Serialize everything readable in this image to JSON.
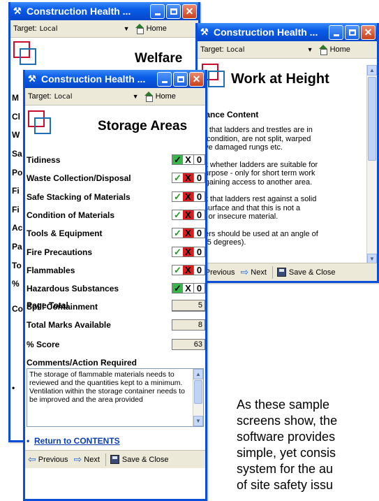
{
  "app_title": "Construction Health ...",
  "target_label": "Target:",
  "target_value": "Local",
  "home_label": "Home",
  "back_window": {
    "heading": "Welfare",
    "fragments": [
      "M",
      "Cl",
      "W",
      "Sa",
      "Po",
      "Fi",
      "Fi",
      "Ac",
      "Pa",
      "To",
      "%",
      "Co",
      "•"
    ]
  },
  "right_window": {
    "heading": "Work at Height",
    "guidance_title": "dance Content",
    "guidance_lines": [
      "re that ladders and trestles are in",
      "d condition, are not split, warped",
      "ave damaged rungs etc.",
      "",
      "ck whether ladders are suitable for",
      "purpose - only for short term work",
      "r gaining access to another area.",
      "",
      "ck that ladders rest against a solid",
      "l surface and that this is not a",
      "le or insecure material.",
      "",
      "ders should be used at an angle of",
      "(75 degrees)."
    ],
    "nav_previous": "Previous",
    "nav_next": "Next",
    "save_close": "Save & Close"
  },
  "front_window": {
    "heading": "Storage Areas",
    "items": [
      {
        "label": "Tidiness",
        "selected": "ok"
      },
      {
        "label": "Waste Collection/Disposal",
        "selected": "no"
      },
      {
        "label": "Safe Stacking of Materials",
        "selected": "no"
      },
      {
        "label": "Condition of Materials",
        "selected": "no"
      },
      {
        "label": "Tools & Equipment",
        "selected": "no"
      },
      {
        "label": "Fire Precautions",
        "selected": "no"
      },
      {
        "label": "Flammables",
        "selected": "no"
      },
      {
        "label": "Hazardous Substances",
        "selected": "ok"
      },
      {
        "label": "Spill Containment",
        "selected": "ok"
      }
    ],
    "mark_ok": "✓",
    "mark_no": "X",
    "mark_zero": "0",
    "page_total_label": "Page Total",
    "page_total_value": "5",
    "total_marks_label": "Total Marks Available",
    "total_marks_value": "8",
    "score_label": "% Score",
    "score_value": "63",
    "comments_label": "Comments/Action Required",
    "comments_text": "The storage of flammable materials needs to reviewed and the quantities kept to a minimum.  Ventilation within the storage container needs to be improved and the area provided",
    "bullet": "•",
    "return_link": "Return to CONTENTS",
    "nav_previous": "Previous",
    "nav_next": "Next",
    "save_close": "Save & Close"
  },
  "caption_lines": [
    "As these sample",
    "screens show, the",
    "software provides",
    "simple, yet consis",
    "system for the au",
    "of site safety issu"
  ],
  "colors": {
    "titlebar": "#0a5ce8",
    "check_green": "#1a9a1a",
    "selected_green": "#39b64a",
    "selected_red": "#d81e1e",
    "link_blue": "#0b3fb0"
  }
}
